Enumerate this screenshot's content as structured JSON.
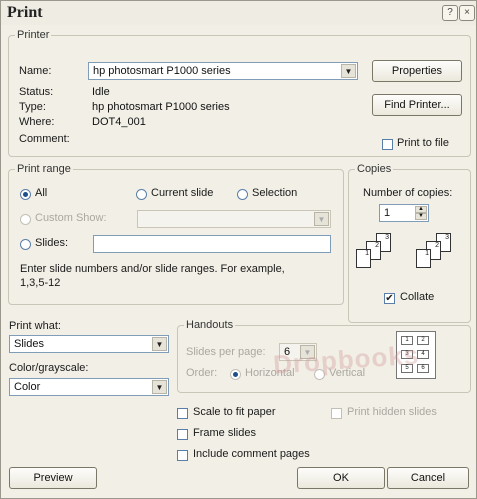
{
  "title": "Print",
  "window_controls": {
    "help": "?",
    "close": "×"
  },
  "printer": {
    "group_label": "Printer",
    "name_label": "Name:",
    "name_value": "hp photosmart P1000 series",
    "status_label": "Status:",
    "status_value": "Idle",
    "type_label": "Type:",
    "type_value": "hp photosmart P1000 series",
    "where_label": "Where:",
    "where_value": "DOT4_001",
    "comment_label": "Comment:",
    "properties_button": "Properties",
    "find_printer_button": "Find Printer...",
    "print_to_file_label": "Print to file",
    "print_to_file_checked": false
  },
  "print_range": {
    "group_label": "Print range",
    "all_label": "All",
    "current_slide_label": "Current slide",
    "selection_label": "Selection",
    "custom_show_label": "Custom Show:",
    "slides_label": "Slides:",
    "slides_value": "",
    "selected": "All",
    "hint": "Enter slide numbers and/or slide ranges. For example,",
    "hint_example": "1,3,5-12"
  },
  "copies": {
    "group_label": "Copies",
    "number_label": "Number of copies:",
    "number_value": "1",
    "collate_label": "Collate",
    "collate_checked": true,
    "page_numbers": [
      "1",
      "2",
      "3"
    ]
  },
  "print_what": {
    "label": "Print what:",
    "value": "Slides"
  },
  "color_grayscale": {
    "label": "Color/grayscale:",
    "value": "Color"
  },
  "handouts": {
    "group_label": "Handouts",
    "slides_per_page_label": "Slides per page:",
    "slides_per_page_value": "6",
    "order_label": "Order:",
    "horizontal_label": "Horizontal",
    "vertical_label": "Vertical",
    "preview_numbers": [
      "1",
      "2",
      "3",
      "4",
      "5",
      "6"
    ]
  },
  "options": {
    "scale_to_fit_label": "Scale to fit paper",
    "frame_slides_label": "Frame slides",
    "include_comments_label": "Include comment pages",
    "print_hidden_label": "Print hidden slides"
  },
  "buttons": {
    "preview": "Preview",
    "ok": "OK",
    "cancel": "Cancel"
  },
  "watermark_text": "Dropbooks"
}
